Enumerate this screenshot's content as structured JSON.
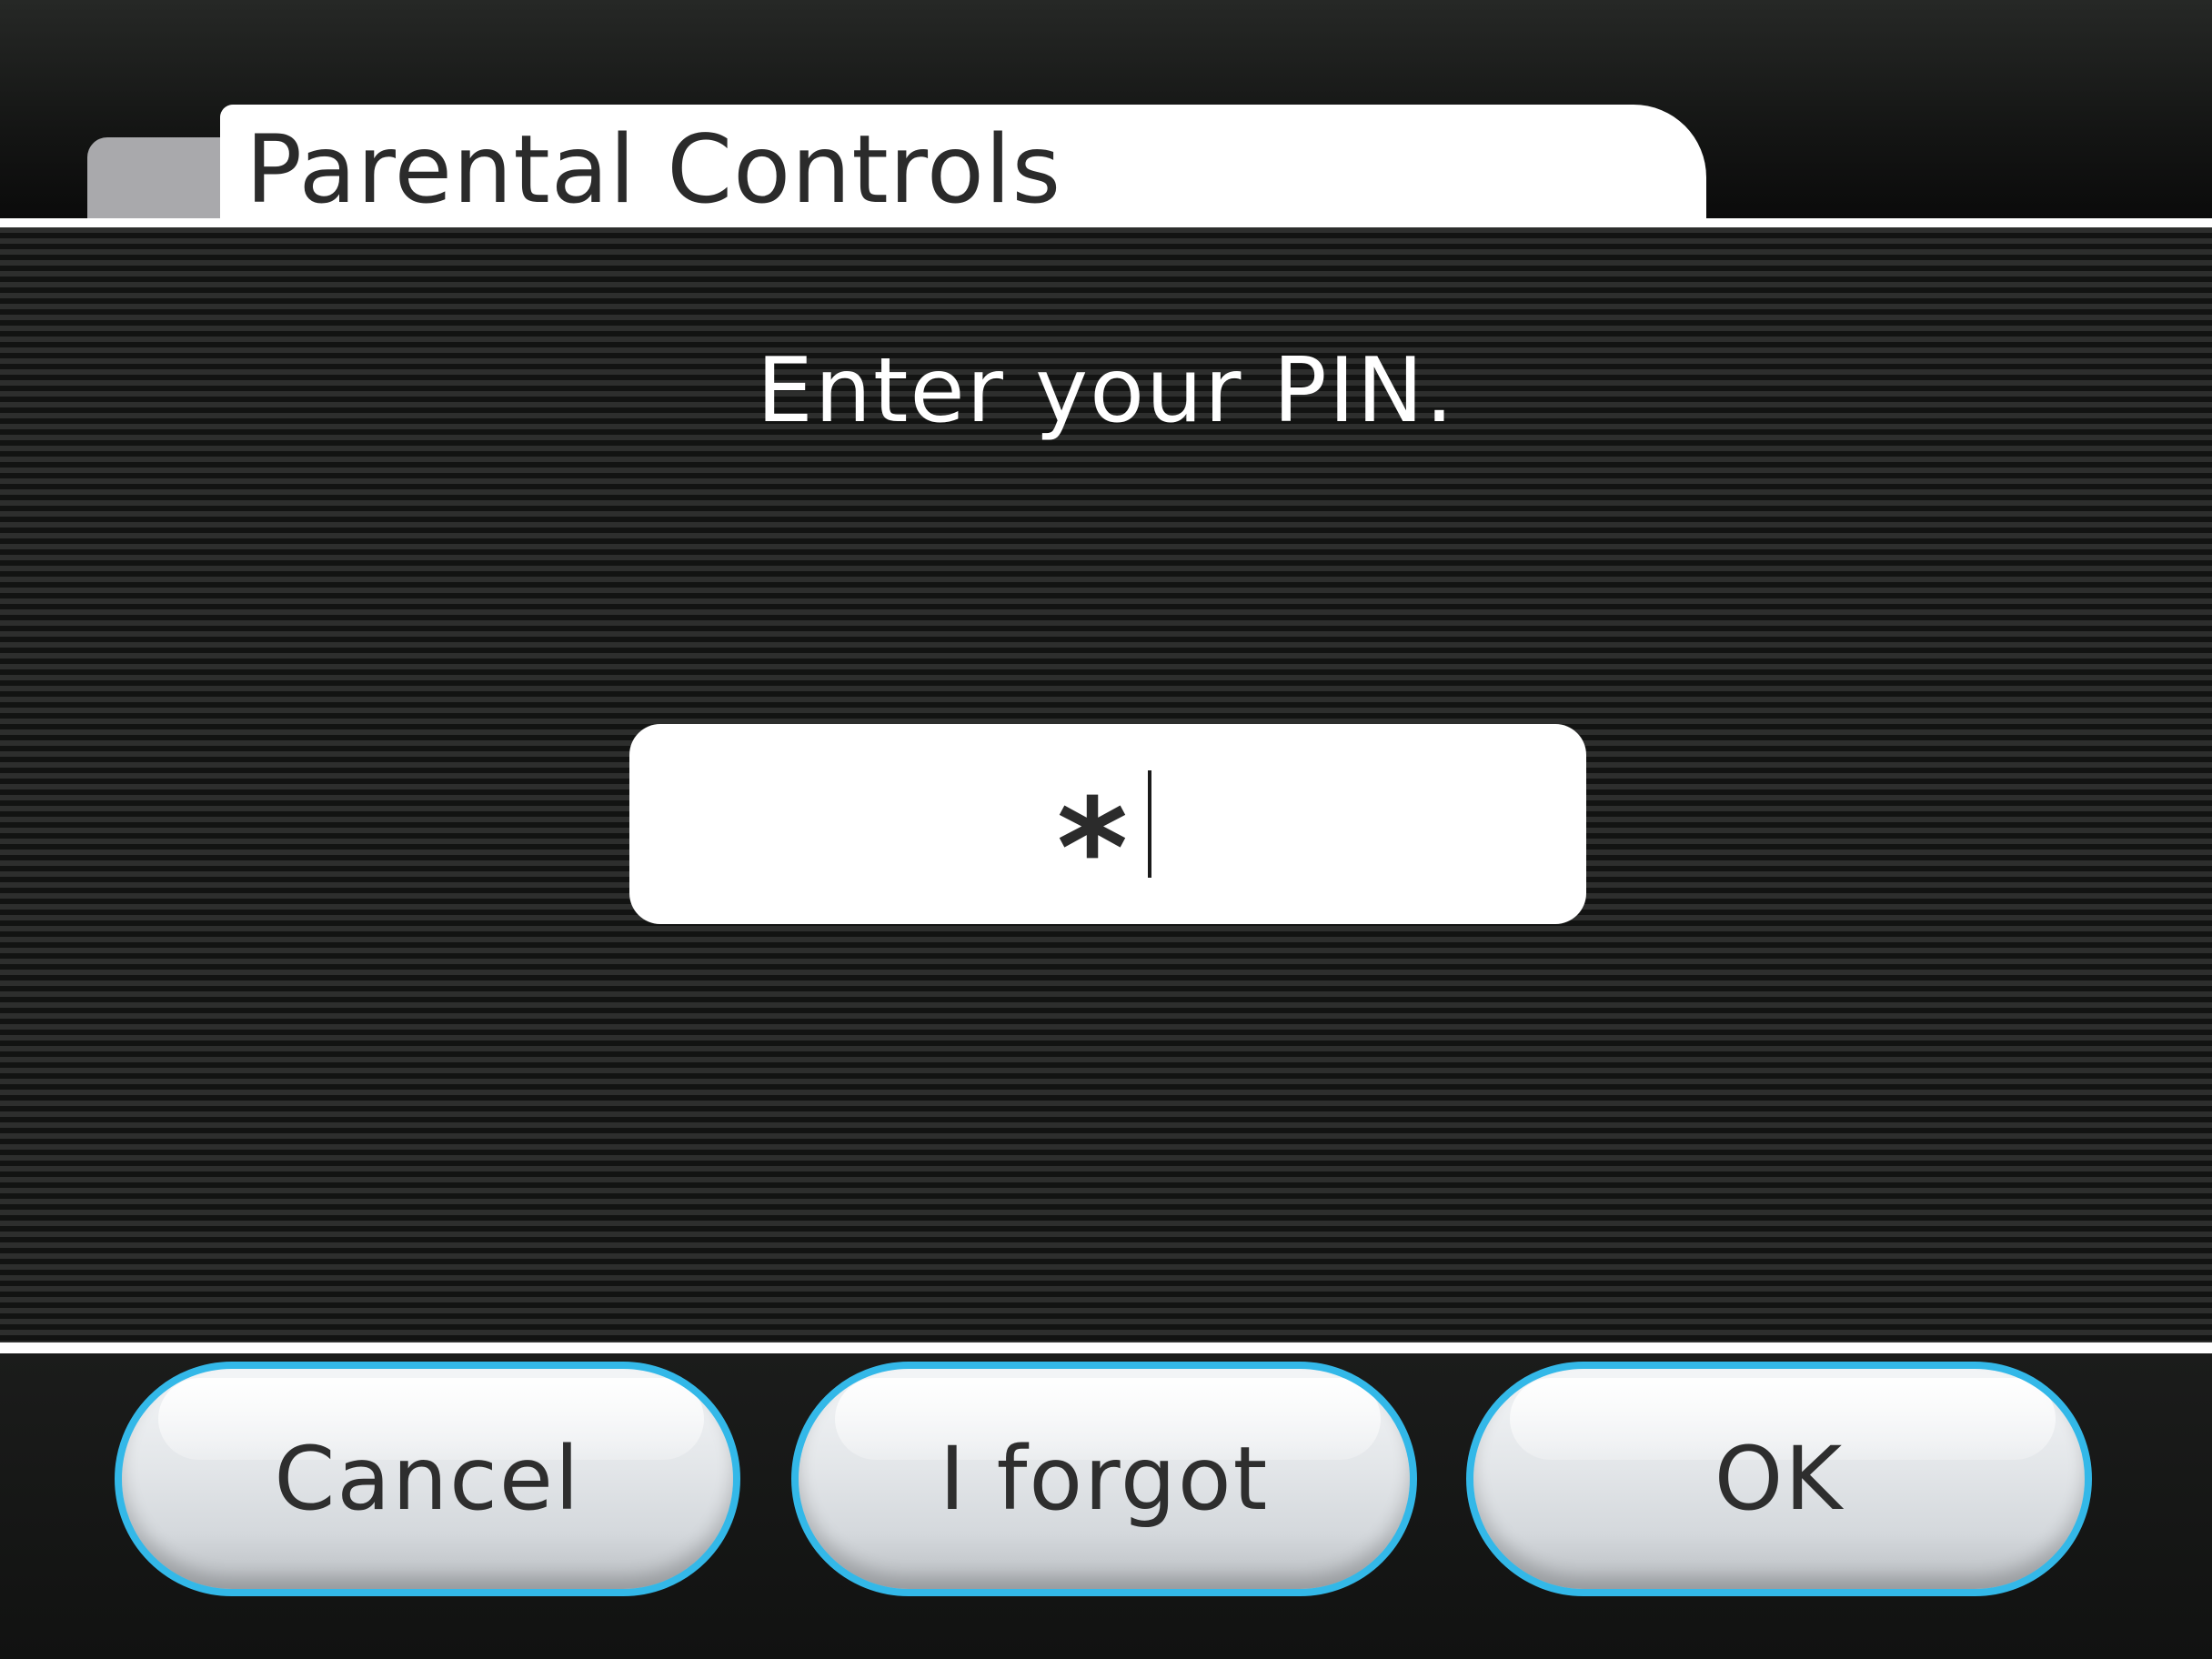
{
  "header": {
    "title": "Parental Controls"
  },
  "main": {
    "prompt": "Enter your PIN.",
    "pin_field": {
      "masked_value": "*"
    }
  },
  "buttons": {
    "cancel_label": "Cancel",
    "forgot_label": "I forgot",
    "ok_label": "OK"
  },
  "colors": {
    "button_border": "#33b8e8",
    "background": "#151615",
    "panel_text": "#ffffff"
  }
}
